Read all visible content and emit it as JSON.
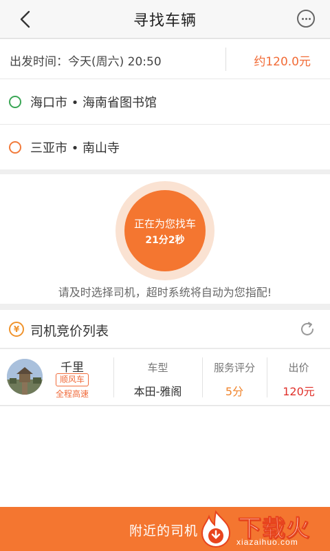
{
  "header": {
    "title": "寻找车辆",
    "back_icon": "chevron-left-icon",
    "more_icon": "more-dots-icon"
  },
  "trip": {
    "time_label": "出发时间：今天(周六) 20:50",
    "price_estimate": "约120.0元",
    "origin": "海口市 • 海南省图书馆",
    "destination": "三亚市 • 南山寺",
    "colors": {
      "origin_dot": "#3aa655",
      "destination_dot": "#f27a3a"
    }
  },
  "search": {
    "status_line1": "正在为您找车",
    "status_line2": "21分2秒",
    "notice": "请及时选择司机，超时系统将自动为您指配!"
  },
  "bids": {
    "title": "司机竞价列表",
    "yen_icon": "yen-icon",
    "refresh_icon": "refresh-icon",
    "drivers": [
      {
        "name": "千里",
        "tag": "顺风车",
        "route": "全程高速",
        "car_model_header": "车型",
        "car_model": "本田-雅阁",
        "rating_header": "服务评分",
        "rating": "5分",
        "price_header": "出价",
        "price": "120元"
      }
    ]
  },
  "bottom": {
    "label": "附近的司机"
  },
  "watermark": {
    "text": "下载火",
    "url": "xiazaihuo.com"
  },
  "colors": {
    "accent": "#f47630",
    "price_red": "#e0302a",
    "rating_orange": "#f0832a"
  }
}
